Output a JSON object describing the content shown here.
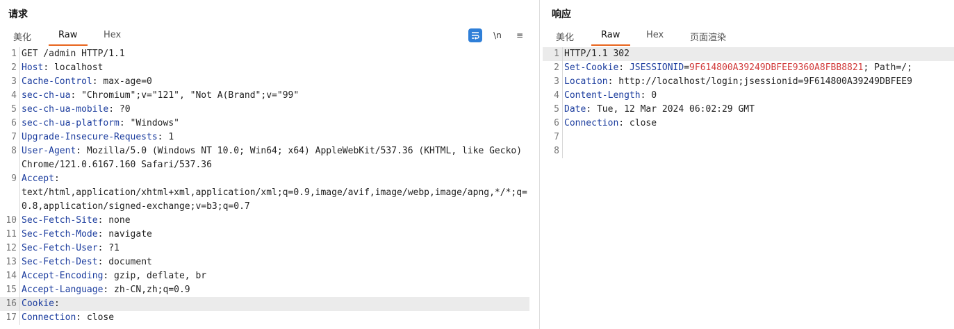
{
  "request": {
    "title": "请求",
    "tabs": [
      "美化",
      "Raw",
      "Hex"
    ],
    "active_tab": "Raw",
    "toolbar": {
      "newline_label": "\\n",
      "menu_glyph": "≡",
      "wrap_icon": "wrap-text-icon"
    },
    "lines": [
      {
        "n": "1",
        "plain": "GET /admin HTTP/1.1"
      },
      {
        "n": "2",
        "name": "Host",
        "value": " localhost"
      },
      {
        "n": "3",
        "name": "Cache-Control",
        "value": " max-age=0"
      },
      {
        "n": "4",
        "name": "sec-ch-ua",
        "value": " \"Chromium\";v=\"121\", \"Not A(Brand\";v=\"99\""
      },
      {
        "n": "5",
        "name": "sec-ch-ua-mobile",
        "value": " ?0"
      },
      {
        "n": "6",
        "name": "sec-ch-ua-platform",
        "value": " \"Windows\""
      },
      {
        "n": "7",
        "name": "Upgrade-Insecure-Requests",
        "value": " 1"
      },
      {
        "n": "8",
        "name": "User-Agent",
        "value": " Mozilla/5.0 (Windows NT 10.0; Win64; x64) AppleWebKit/537.36 (KHTML, like Gecko) Chrome/121.0.6167.160 Safari/537.36"
      },
      {
        "n": "9",
        "name": "Accept",
        "value": "\ntext/html,application/xhtml+xml,application/xml;q=0.9,image/avif,image/webp,image/apng,*/*;q=0.8,application/signed-exchange;v=b3;q=0.7"
      },
      {
        "n": "10",
        "name": "Sec-Fetch-Site",
        "value": " none"
      },
      {
        "n": "11",
        "name": "Sec-Fetch-Mode",
        "value": " navigate"
      },
      {
        "n": "12",
        "name": "Sec-Fetch-User",
        "value": " ?1"
      },
      {
        "n": "13",
        "name": "Sec-Fetch-Dest",
        "value": " document"
      },
      {
        "n": "14",
        "name": "Accept-Encoding",
        "value": " gzip, deflate, br"
      },
      {
        "n": "15",
        "name": "Accept-Language",
        "value": " zh-CN,zh;q=0.9"
      },
      {
        "n": "16",
        "name": "Cookie",
        "value": "",
        "highlight": true
      },
      {
        "n": "17",
        "name": "Connection",
        "value": " close"
      }
    ]
  },
  "response": {
    "title": "响应",
    "tabs": [
      "美化",
      "Raw",
      "Hex",
      "页面渲染"
    ],
    "active_tab": "Raw",
    "lines": [
      {
        "n": "1",
        "plain": "HTTP/1.1 302",
        "highlight": true
      },
      {
        "n": "2",
        "name": "Set-Cookie",
        "parts": [
          {
            "t": " "
          },
          {
            "t": "JSESSIONID",
            "c": "name"
          },
          {
            "t": "="
          },
          {
            "t": "9F614800A39249DBFEE9360A8FBB8821",
            "c": "red"
          },
          {
            "t": "; Path=/;"
          }
        ]
      },
      {
        "n": "3",
        "name": "Location",
        "value": " http://localhost/login;jsessionid=9F614800A39249DBFEE9"
      },
      {
        "n": "4",
        "name": "Content-Length",
        "value": " 0"
      },
      {
        "n": "5",
        "name": "Date",
        "value": " Tue, 12 Mar 2024 06:02:29 GMT"
      },
      {
        "n": "6",
        "name": "Connection",
        "value": " close"
      },
      {
        "n": "7",
        "plain": ""
      },
      {
        "n": "8",
        "plain": ""
      }
    ]
  }
}
